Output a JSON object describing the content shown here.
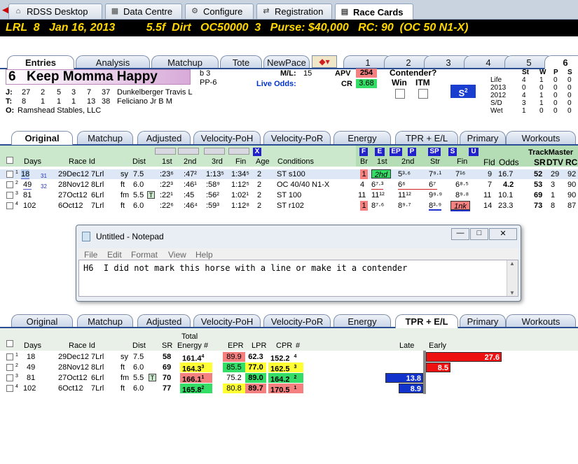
{
  "app_tabs": [
    "RDSS Desktop",
    "Data Centre",
    "Configure",
    "Registration",
    "Race Cards"
  ],
  "race_header": "LRL  8   Jan 16, 2013          5.5f  Dirt   OC50000  3   Purse: $40,000   RC: 90  (OC 50 N1-X)",
  "horse_tabs": [
    "Entries",
    "Analysis",
    "Matchup",
    "Tote",
    "NewPace"
  ],
  "post_tabs": [
    "1",
    "2",
    "3",
    "4",
    "5",
    "6"
  ],
  "horse": {
    "number": "6",
    "name": "Keep Momma Happy",
    "sex_age": "b 3",
    "pp": "PP-6",
    "ml_label": "M/L:",
    "ml_value": "15",
    "live_odds_label": "Live Odds:",
    "apv_label": "APV",
    "apv_value": "254",
    "cr_label": "CR",
    "cr_value": "3.68",
    "contender_label": "Contender?",
    "win_label": "Win",
    "itm_label": "ITM",
    "s2_label": "S",
    "s2_sup": "2"
  },
  "jockey": {
    "j_label": "J:",
    "t_label": "T:",
    "o_label": "O:",
    "j_stats": [
      "27",
      "2",
      "5",
      "3",
      "7",
      "37"
    ],
    "t_stats": [
      "8",
      "1",
      "1",
      "1",
      "13",
      "38"
    ],
    "jockey_name": "Dunkelberger Travis L",
    "trainer_name": "Feliciano Jr B M",
    "owner": "Ramshead Stables, LLC"
  },
  "record": {
    "headers": [
      "St",
      "W",
      "P",
      "S"
    ],
    "rows": [
      [
        "Life",
        "4",
        "1",
        "0",
        "0"
      ],
      [
        "2013",
        "0",
        "0",
        "0",
        "0"
      ],
      [
        "2012",
        "4",
        "1",
        "0",
        "0"
      ],
      [
        "S/D",
        "3",
        "1",
        "0",
        "0"
      ],
      [
        "Wet",
        "1",
        "0",
        "0",
        "0"
      ]
    ]
  },
  "pp_tabs": [
    "Original",
    "Matchup",
    "Adjusted",
    "Velocity-PoH",
    "Velocity-PoR",
    "Energy",
    "TPR + E/L",
    "Primary",
    "Workouts"
  ],
  "pp_top_buttons": [
    "F",
    "E",
    "EP",
    "P",
    "SP",
    "S",
    "U"
  ],
  "pp_x": "X",
  "trackmaster": "TrackMaster",
  "pp_headers": {
    "days": "Days",
    "race_id": "Race Id",
    "dist": "Dist",
    "c1": "1st",
    "c2": "2nd",
    "c3": "3rd",
    "fin": "Fin",
    "age": "Age",
    "cond": "Conditions",
    "br": "Br",
    "b1": "1st",
    "b2": "2nd",
    "str": "Str",
    "fin2": "Fin",
    "fld": "Fld",
    "odds": "Odds",
    "sr": "SR",
    "dtv": "DTV",
    "rc": "RC"
  },
  "pp_rows": [
    {
      "n": "1",
      "days": "18",
      "d2": "31",
      "date": "29Dec12",
      "race": "7Lrl",
      "surf": "sy",
      "dist": "7.5",
      "f1": ":23⁶",
      "f2": ":47²",
      "f3": "1:13⁵",
      "fin": "1:34⁵",
      "age": "2",
      "cond": "ST s100",
      "br": "1",
      "p1": "2hd",
      "p2": "5³·⁶",
      "str": "7⁹·¹",
      "pf": "7¹⁶",
      "fld": "9",
      "odds": "16.7",
      "sr": "52",
      "dtv": "29",
      "rc": "92"
    },
    {
      "n": "2",
      "days": "49",
      "d2": "32",
      "date": "28Nov12",
      "race": "8Lrl",
      "surf": "ft",
      "dist": "6.0",
      "f1": ":22³",
      "f2": ":46¹",
      "f3": ":58⁹",
      "fin": "1:12⁵",
      "age": "2",
      "cond": "OC 40/40 N1-X",
      "br": "4",
      "p1": "6⁷·³",
      "p2": "6⁶",
      "str": "6⁷",
      "pf": "6⁸·⁵",
      "fld": "7",
      "odds": "4.2",
      "sr": "53",
      "dtv": "3",
      "rc": "90"
    },
    {
      "n": "3",
      "days": "81",
      "d2": "",
      "date": "27Oct12",
      "race": "6Lrl",
      "surf": "fm",
      "dist": "5.5",
      "f1": ":22¹",
      "f2": ":45",
      "f3": ":56²",
      "fin": "1:02¹",
      "age": "2",
      "cond": "ST 100",
      "br": "11",
      "p1": "11¹²",
      "p2": "11¹²",
      "str": "9⁹·⁹",
      "pf": "8⁹·⁸",
      "fld": "11",
      "odds": "10.1",
      "sr": "69",
      "dtv": "1",
      "rc": "90"
    },
    {
      "n": "4",
      "days": "102",
      "d2": "",
      "date": "6Oct12",
      "race": "7Lrl",
      "surf": "ft",
      "dist": "6.0",
      "f1": ":22⁶",
      "f2": ":46⁴",
      "f3": ":59³",
      "fin": "1:12⁸",
      "age": "2",
      "cond": "ST r102",
      "br": "1",
      "p1": "8⁷·⁶",
      "p2": "8⁹·⁷",
      "str": "8³·⁹",
      "pf": "1nk",
      "fld": "14",
      "odds": "23.3",
      "sr": "73",
      "dtv": "8",
      "rc": "87"
    }
  ],
  "pp_t_badge": "T",
  "notepad": {
    "title": "Untitled - Notepad",
    "menu": [
      "File",
      "Edit",
      "Format",
      "View",
      "Help"
    ],
    "text": "H6  I did not mark this horse with a line or make it a contender"
  },
  "summary_headers": {
    "days": "Days",
    "race_id": "Race Id",
    "dist": "Dist",
    "sr": "SR",
    "total": "Total",
    "energy": "Energy",
    "num": "#",
    "epr": "EPR",
    "lpr": "LPR",
    "cpr": "CPR",
    "num2": "#",
    "late": "Late",
    "early": "Early"
  },
  "summary_rows": [
    {
      "n": "1",
      "days": "18",
      "date": "29Dec12",
      "race": "7Lrl",
      "surf": "sy",
      "dist": "7.5",
      "sr": "58",
      "energy": "161.4",
      "er": "4",
      "epr": "89.9",
      "lpr": "62.3",
      "cpr": "152.2",
      "cr": "4",
      "bar": "27.6",
      "side": "early",
      "frac": 0.5
    },
    {
      "n": "2",
      "days": "49",
      "date": "28Nov12",
      "race": "8Lrl",
      "surf": "ft",
      "dist": "6.0",
      "sr": "69",
      "energy": "164.3",
      "er": "3",
      "epr": "85.5",
      "lpr": "77.0",
      "cpr": "162.5",
      "cr": "3",
      "bar": "8.5",
      "side": "early",
      "frac": 0.16
    },
    {
      "n": "3",
      "days": "81",
      "date": "27Oct12",
      "race": "6Lrl",
      "surf": "fm",
      "dist": "5.5",
      "sr": "70",
      "energy": "166.1",
      "er": "1",
      "epr": "75.2",
      "lpr": "89.0",
      "cpr": "164.2",
      "cr": "2",
      "bar": "13.8",
      "side": "late",
      "frac": 0.25
    },
    {
      "n": "4",
      "days": "102",
      "date": "6Oct12",
      "race": "7Lrl",
      "surf": "ft",
      "dist": "6.0",
      "sr": "77",
      "energy": "165.8",
      "er": "2",
      "epr": "80.8",
      "lpr": "89.7",
      "cpr": "170.5",
      "cr": "1",
      "bar": "8.9",
      "side": "late",
      "frac": 0.16
    }
  ],
  "colors": {
    "red": "#f48080",
    "yellow": "#ffff33",
    "green": "#33dd66",
    "bar_red": "#ee1111",
    "bar_blue": "#1133cc"
  }
}
